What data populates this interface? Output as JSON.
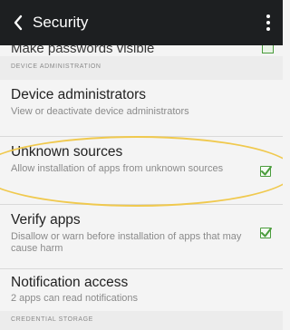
{
  "appbar": {
    "title": "Security",
    "back_icon": "back-chevron-icon",
    "overflow_icon": "overflow-menu-icon"
  },
  "previous_row": {
    "label": "Make passwords visible",
    "checked": true
  },
  "sections": {
    "device_administration": "DEVICE ADMINISTRATION",
    "credential_storage": "CREDENTIAL STORAGE"
  },
  "rows": {
    "device_admins": {
      "title": "Device administrators",
      "summary": "View or deactivate device administrators"
    },
    "unknown_sources": {
      "title": "Unknown sources",
      "summary": "Allow installation of apps from unknown sources",
      "checked": true
    },
    "verify_apps": {
      "title": "Verify apps",
      "summary": "Disallow or warn before installation of apps that may cause harm",
      "checked": true
    },
    "notification_access": {
      "title": "Notification access",
      "summary": "2 apps can read notifications"
    }
  },
  "colors": {
    "appbar": "#1d1f21",
    "checkbox_green": "#4a9c3c",
    "highlight_yellow": "#f0c94e"
  }
}
